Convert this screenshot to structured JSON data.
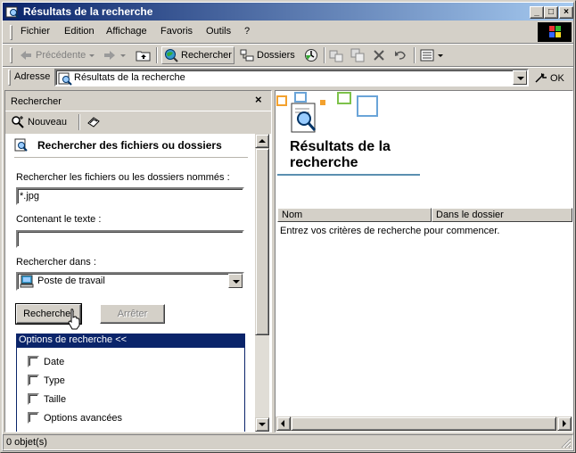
{
  "window": {
    "title": "Résultats de la recherche",
    "controls": {
      "minimize": "_",
      "maximize": "□",
      "close": "×"
    }
  },
  "menu": {
    "items": [
      "Fichier",
      "Edition",
      "Affichage",
      "Favoris",
      "Outils",
      "?"
    ]
  },
  "toolbar": {
    "back_label": "Précédente",
    "search_label": "Rechercher",
    "folders_label": "Dossiers"
  },
  "address": {
    "label": "Adresse",
    "value": "Résultats de la recherche",
    "go_label": "OK"
  },
  "search_pane": {
    "title": "Rechercher",
    "close_glyph": "×",
    "new_label": "Nouveau",
    "heading": "Rechercher des fichiers ou dossiers",
    "name_label": "Rechercher les fichiers ou les dossiers nommés :",
    "name_value": "*.jpg",
    "text_label": "Contenant le texte :",
    "text_value": "",
    "look_in_label": "Rechercher dans :",
    "look_in_value": "Poste de travail",
    "search_button": "Rechercher",
    "stop_button": "Arrêter",
    "options_header": "Options de recherche <<",
    "options": [
      {
        "label": "Date",
        "checked": false
      },
      {
        "label": "Type",
        "checked": false
      },
      {
        "label": "Taille",
        "checked": false
      },
      {
        "label": "Options avancées",
        "checked": false
      }
    ]
  },
  "results": {
    "title_line1": "Résultats de la",
    "title_line2": "recherche",
    "columns": [
      "Nom",
      "Dans le dossier"
    ],
    "empty_message": "Entrez vos critères de recherche pour commencer."
  },
  "status": {
    "text": "0 objet(s)"
  },
  "colors": {
    "title_start": "#0a246a",
    "title_end": "#a6caf0",
    "face": "#d4d0c8",
    "selection": "#0a246a",
    "accent_underline": "#5b8fb0"
  }
}
